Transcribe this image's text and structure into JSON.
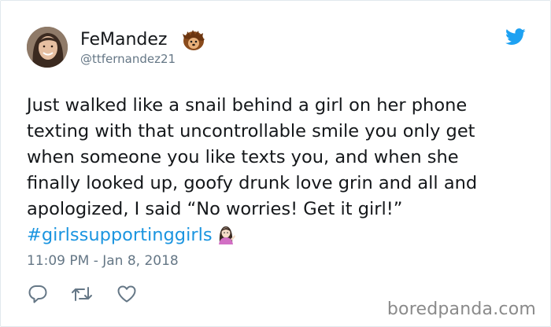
{
  "tweet": {
    "author": {
      "display_name": "FeMandez",
      "handle": "@ttfernandez21",
      "name_emoji": "hedgehog"
    },
    "text_lines": [
      "Just walked like a snail behind a girl on her phone",
      "texting with that uncontrollable smile you only get",
      "when someone you like texts you, and when she",
      "finally looked up, goofy drunk love grin and all and",
      "apologized, I said “No worries! Get it girl!”"
    ],
    "hashtag": "#girlssupportinggirls",
    "trailing_emoji": "woman-tipping-hand",
    "timestamp": "11:09 PM - Jan 8, 2018"
  },
  "actions": {
    "reply_icon": "reply-icon",
    "retweet_icon": "retweet-icon",
    "like_icon": "heart-icon"
  },
  "brand_icon": "twitter-bird-icon",
  "watermark": "boredpanda.com",
  "colors": {
    "text": "#14171a",
    "secondary": "#657786",
    "link": "#1b95e0",
    "twitter_blue": "#1da1f2",
    "border": "#e1e8ed",
    "watermark": "#8a8a8a"
  }
}
